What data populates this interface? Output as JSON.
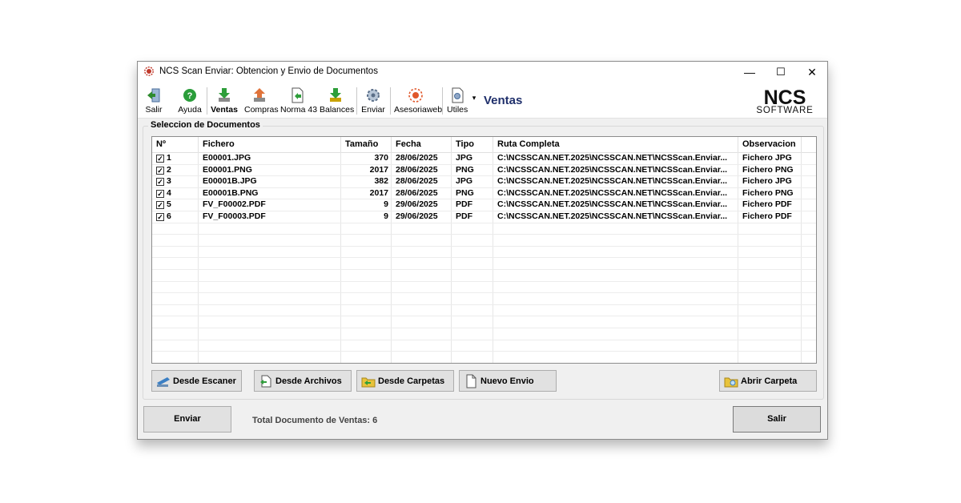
{
  "window": {
    "title": "NCS Scan Enviar: Obtencion y Envio de Documentos",
    "controls": {
      "minimize": "—",
      "maximize": "☐",
      "close": "✕"
    }
  },
  "toolbar": {
    "items": [
      {
        "label": "Salir",
        "icon": "exit-icon"
      },
      {
        "label": "Ayuda",
        "icon": "help-icon"
      },
      {
        "label": "Ventas",
        "icon": "ventas-download-icon",
        "active": true
      },
      {
        "label": "Compras",
        "icon": "compras-icon"
      },
      {
        "label": "Norma 43",
        "icon": "norma43-icon"
      },
      {
        "label": "Balances",
        "icon": "balances-icon"
      },
      {
        "label": "Enviar",
        "icon": "send-gear-icon"
      },
      {
        "label": "Asesoriaweb",
        "icon": "web-icon"
      },
      {
        "label": "Utiles",
        "icon": "tools-icon"
      }
    ],
    "section_title": "Ventas",
    "logo_top": "NCS",
    "logo_bottom": "SOFTWARE"
  },
  "selection": {
    "label": "Seleccion de Documentos",
    "columns": [
      "Nº",
      "Fichero",
      "Tamaño",
      "Fecha",
      "Tipo",
      "Ruta Completa",
      "Observacion"
    ],
    "rows": [
      {
        "n": "1",
        "file": "E00001.JPG",
        "size": "370",
        "date": "28/06/2025",
        "type": "JPG",
        "path": "C:\\NCSSCAN.NET.2025\\NCSSCAN.NET\\NCSScan.Enviar...",
        "obs": "Fichero JPG",
        "checked": true
      },
      {
        "n": "2",
        "file": "E00001.PNG",
        "size": "2017",
        "date": "28/06/2025",
        "type": "PNG",
        "path": "C:\\NCSSCAN.NET.2025\\NCSSCAN.NET\\NCSScan.Enviar...",
        "obs": "Fichero PNG",
        "checked": true
      },
      {
        "n": "3",
        "file": "E00001B.JPG",
        "size": "382",
        "date": "28/06/2025",
        "type": "JPG",
        "path": "C:\\NCSSCAN.NET.2025\\NCSSCAN.NET\\NCSScan.Enviar...",
        "obs": "Fichero JPG",
        "checked": true
      },
      {
        "n": "4",
        "file": "E00001B.PNG",
        "size": "2017",
        "date": "28/06/2025",
        "type": "PNG",
        "path": "C:\\NCSSCAN.NET.2025\\NCSSCAN.NET\\NCSScan.Enviar...",
        "obs": "Fichero PNG",
        "checked": true
      },
      {
        "n": "5",
        "file": "FV_F00002.PDF",
        "size": "9",
        "date": "29/06/2025",
        "type": "PDF",
        "path": "C:\\NCSSCAN.NET.2025\\NCSSCAN.NET\\NCSScan.Enviar...",
        "obs": "Fichero PDF",
        "checked": true
      },
      {
        "n": "6",
        "file": "FV_F00003.PDF",
        "size": "9",
        "date": "29/06/2025",
        "type": "PDF",
        "path": "C:\\NCSSCAN.NET.2025\\NCSSCAN.NET\\NCSScan.Enviar...",
        "obs": "Fichero PDF",
        "checked": true
      }
    ]
  },
  "actions": {
    "scanner": "Desde Escaner",
    "files": "Desde Archivos",
    "folders": "Desde Carpetas",
    "new_send": "Nuevo Envio",
    "open_folder": "Abrir Carpeta"
  },
  "footer": {
    "send": "Enviar",
    "total": "Total Documento de Ventas: 6",
    "exit": "Salir"
  },
  "colors": {
    "section_title": "#1f2f6b",
    "window_bg": "#f0f0f0"
  }
}
